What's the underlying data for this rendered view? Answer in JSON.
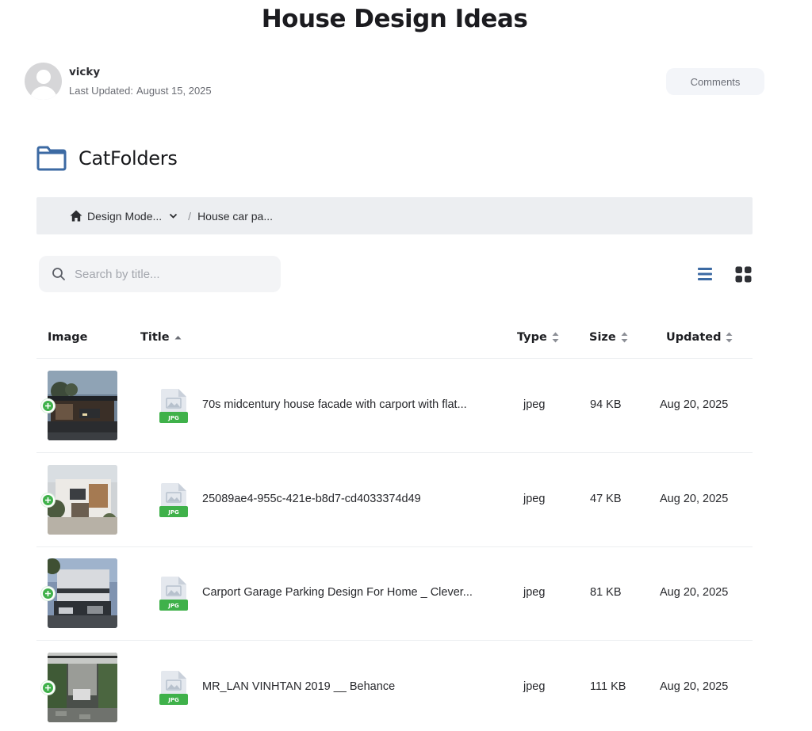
{
  "page": {
    "title": "House Design Ideas"
  },
  "author": {
    "name": "vicky",
    "updated_label": "Last Updated:",
    "updated_date": "August 15, 2025"
  },
  "comments_button": "Comments",
  "catfolders": {
    "title": "CatFolders"
  },
  "breadcrumb": {
    "items": [
      "Design Mode...",
      "House car pa..."
    ],
    "separator": "/"
  },
  "search": {
    "placeholder": "Search by title..."
  },
  "table": {
    "headers": {
      "image": "Image",
      "title": "Title",
      "type": "Type",
      "size": "Size",
      "updated": "Updated"
    },
    "rows": [
      {
        "title": "70s midcentury house facade with carport with flat...",
        "type": "jpeg",
        "size": "94 KB",
        "updated": "Aug 20, 2025",
        "badge": "JPG"
      },
      {
        "title": "25089ae4-955c-421e-b8d7-cd4033374d49",
        "type": "jpeg",
        "size": "47 KB",
        "updated": "Aug 20, 2025",
        "badge": "JPG"
      },
      {
        "title": "Carport Garage Parking Design For Home _ Clever...",
        "type": "jpeg",
        "size": "81 KB",
        "updated": "Aug 20, 2025",
        "badge": "JPG"
      },
      {
        "title": "MR_LAN VINHTAN 2019 __ Behance",
        "type": "jpeg",
        "size": "111 KB",
        "updated": "Aug 20, 2025",
        "badge": "JPG"
      }
    ]
  },
  "colors": {
    "accent": "#3c6aa3",
    "badge_green": "#3fb14a",
    "breadcrumb_bg": "#eceef1"
  }
}
